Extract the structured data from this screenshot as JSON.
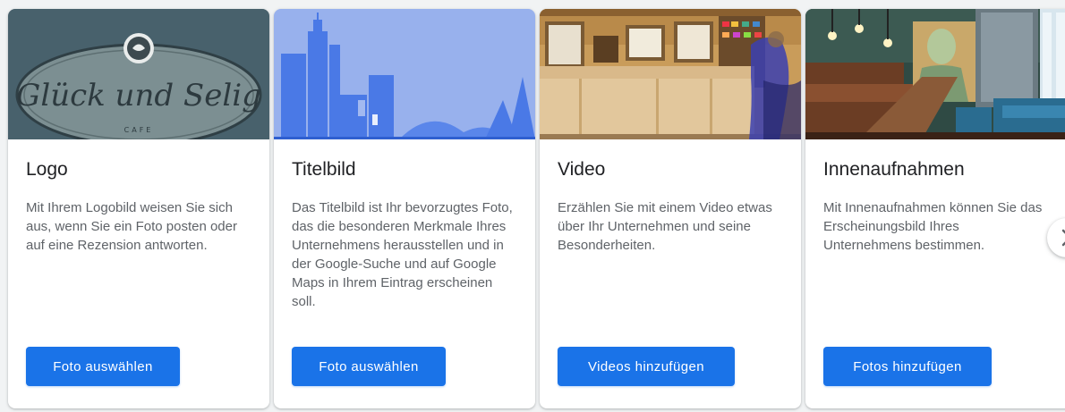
{
  "cards": [
    {
      "title": "Logo",
      "description": "Mit Ihrem Logobild weisen Sie sich aus, wenn Sie ein Foto posten oder auf eine Rezension antworten.",
      "button_label": "Foto auswählen",
      "image": {
        "type": "logo-photo",
        "logo_text": "Glück und Selig",
        "logo_subtext": "CAFE"
      }
    },
    {
      "title": "Titelbild",
      "description": "Das Titelbild ist Ihr bevorzugtes Foto, das die besonderen Merkmale Ihres Unternehmens herausstellen und in der Google-Suche und auf Google Maps in Ihrem Eintrag erscheinen soll.",
      "button_label": "Foto auswählen",
      "image": {
        "type": "cover-illustration"
      }
    },
    {
      "title": "Video",
      "description": "Erzählen Sie mit einem Video etwas über Ihr Unternehmen und seine Besonderheiten.",
      "button_label": "Videos hinzufügen",
      "image": {
        "type": "cafe-counter-photo"
      }
    },
    {
      "title": "Innenaufnahmen",
      "description": "Mit Innenaufnahmen können Sie das Erscheinungsbild Ihres Unternehmens bestimmen.",
      "button_label": "Fotos hinzufügen",
      "image": {
        "type": "interior-photo"
      }
    }
  ],
  "colors": {
    "primary_button": "#1a73e8",
    "title_text": "#202124",
    "body_text": "#5f6368",
    "background": "#f1f3f4"
  },
  "icons": {
    "carousel_next": "chevron-right-icon"
  }
}
